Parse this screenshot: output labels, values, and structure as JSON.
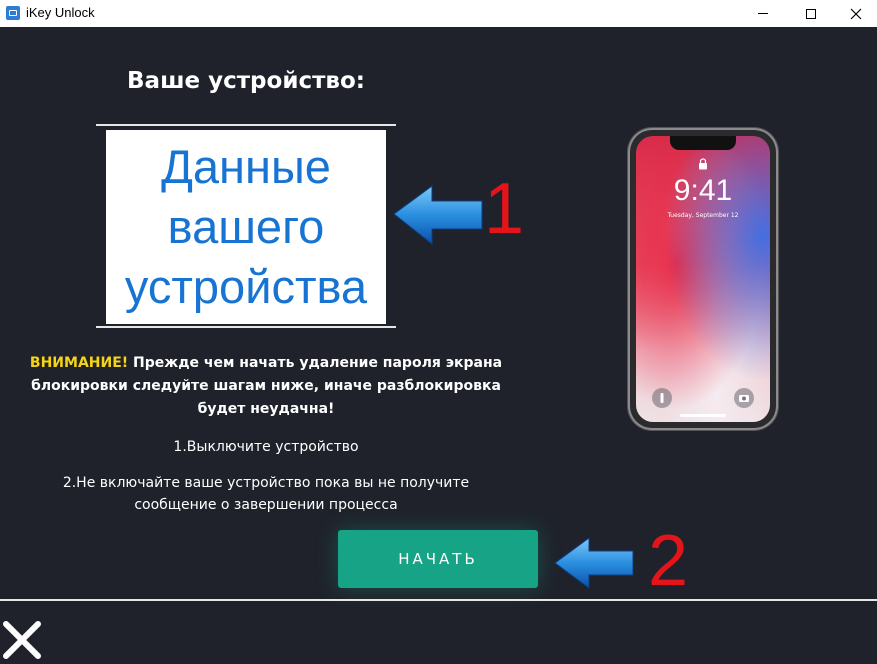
{
  "window": {
    "title": "iKey Unlock"
  },
  "main": {
    "heading": "Ваше устройство:",
    "device_info": "Данные\nвашего\nустройства",
    "annotation_1": "1",
    "annotation_2": "2",
    "warning_label": "ВНИМАНИЕ!",
    "warning_text": "Прежде чем начать удаление пароля экрана блокировки следуйте шагам ниже, иначе разблокировка будет неудачна!",
    "step_1": "1.Выключите устройство",
    "step_2": "2.Не включайте ваше устройство пока вы не получите сообщение о завершении процесса",
    "start_button": "НАЧАТЬ"
  },
  "phone": {
    "time": "9:41",
    "date": "Tuesday, September 12"
  },
  "colors": {
    "background": "#1f222b",
    "accent_button": "#17a386",
    "warning": "#f5d417",
    "annotation": "#e3141a",
    "device_text": "#1874d2"
  },
  "icons": [
    "app-icon",
    "minimize-icon",
    "maximize-icon",
    "close-icon",
    "arrow-left-icon",
    "close-x-icon",
    "lock-icon",
    "flashlight-icon",
    "camera-icon"
  ]
}
